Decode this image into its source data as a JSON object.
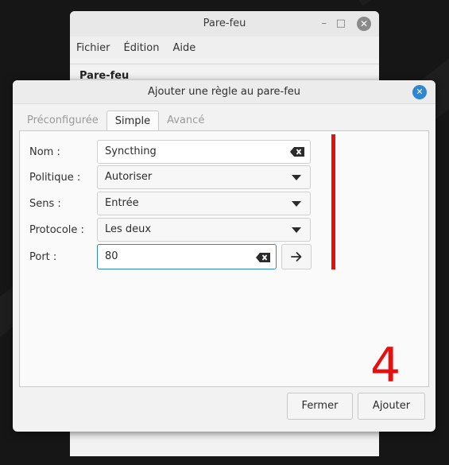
{
  "back_window": {
    "title": "Pare-feu",
    "minimize_glyph": "–",
    "maximize_glyph": "□",
    "close_glyph": "✕",
    "menu": [
      "Fichier",
      "Édition",
      "Aide"
    ],
    "heading": "Pare-feu"
  },
  "dialog": {
    "title": "Ajouter une règle au pare-feu",
    "close_glyph": "✕",
    "tabs": [
      {
        "label": "Préconfigurée",
        "active": false
      },
      {
        "label": "Simple",
        "active": true
      },
      {
        "label": "Avancé",
        "active": false
      }
    ],
    "form": {
      "name": {
        "label": "Nom :",
        "value": "Syncthing"
      },
      "policy": {
        "label": "Politique :",
        "value": "Autoriser"
      },
      "direction": {
        "label": "Sens :",
        "value": "Entrée"
      },
      "protocol": {
        "label": "Protocole :",
        "value": "Les deux"
      },
      "port": {
        "label": "Port :",
        "value": "80"
      }
    },
    "buttons": {
      "close": "Fermer",
      "add": "Ajouter"
    }
  },
  "annotation": {
    "step_number": "4",
    "color": "#e8100f"
  },
  "colors": {
    "accent": "#2f86d4",
    "annotation_red": "#e8100f"
  },
  "icons": {
    "clear": "clear-text-icon",
    "dropdown": "chevron-down-icon",
    "go": "arrow-right-icon"
  }
}
